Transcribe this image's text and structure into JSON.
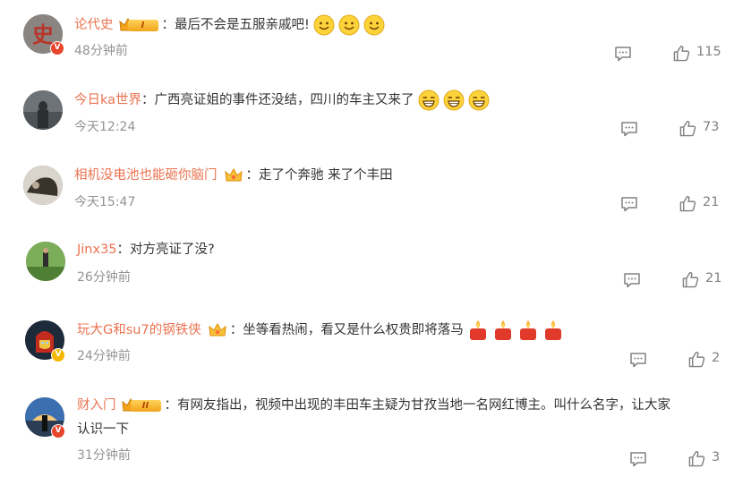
{
  "comments": [
    {
      "name": "论代史",
      "rank": "I",
      "text": "最后不会是五服亲戚吧!",
      "time": "48分钟前",
      "likes": "115",
      "emoji": "smile-emoji"
    },
    {
      "name": "今日ka世界",
      "text": "广西亮证姐的事件还没结，四川的车主又来了",
      "time": "今天12:24",
      "likes": "73",
      "emoji": "grin-emoji"
    },
    {
      "name": "相机没电池也能砸你脑门",
      "text": "走了个奔驰 来了个丰田",
      "time": "今天15:47",
      "likes": "21"
    },
    {
      "name": "Jinx35",
      "text": "对方亮证了没?",
      "time": "26分钟前",
      "likes": "21"
    },
    {
      "name": "玩大G和su7的钢铁侠",
      "text": "坐等看热闹，看又是什么权贵即将落马",
      "time": "24分钟前",
      "likes": "2",
      "emoji": "candle-emoji"
    },
    {
      "name": "财入门",
      "rank": "II",
      "text_line1": "有网友指出，视频中出现的丰田车主疑为甘孜当地一名网红博主。叫什么名字，让大家",
      "text_line2": "认识一下",
      "time": "31分钟前",
      "likes": "3"
    }
  ],
  "colors": {
    "name": "#eb7350",
    "text": "#333333",
    "meta": "#939393",
    "verified_red": "#e8452c",
    "verified_gold": "#f5b800"
  },
  "icons": {
    "reply": "comment-icon",
    "like": "thumbs-up-icon"
  }
}
